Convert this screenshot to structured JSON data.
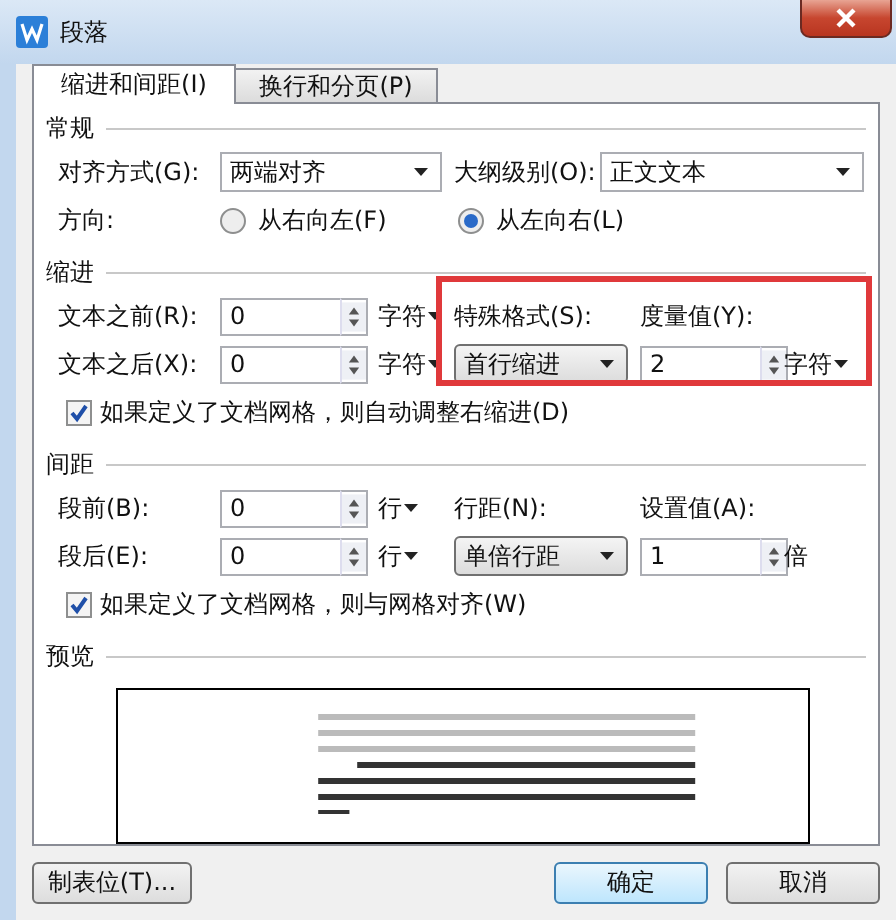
{
  "window": {
    "title": "段落"
  },
  "tabs": [
    {
      "label": "缩进和间距(I)",
      "selected": true
    },
    {
      "label": "换行和分页(P)",
      "selected": false
    }
  ],
  "general": {
    "label": "常规",
    "alignment": {
      "label": "对齐方式(G):",
      "value": "两端对齐",
      "kind": "field"
    },
    "outline_level": {
      "label": "大纲级别(O):",
      "value": "正文文本",
      "kind": "field"
    },
    "direction": {
      "label": "方向:",
      "options": [
        {
          "label": "从右向左(F)",
          "selected": false
        },
        {
          "label": "从左向右(L)",
          "selected": true
        }
      ]
    }
  },
  "indent": {
    "label": "缩进",
    "before": {
      "label": "文本之前(R):",
      "value": "0",
      "unit": "字符",
      "menu": true
    },
    "after": {
      "label": "文本之后(X):",
      "value": "0",
      "unit": "字符",
      "menu": true
    },
    "special": {
      "label": "特殊格式(S):",
      "value": "首行缩进",
      "kind": "button"
    },
    "measure": {
      "label": "度量值(Y):",
      "value": "2",
      "unit": "字符",
      "menu": true
    },
    "auto_adjust": {
      "label": "如果定义了文档网格，则自动调整右缩进(D)",
      "checked": true
    }
  },
  "spacing": {
    "label": "间距",
    "before": {
      "label": "段前(B):",
      "value": "0",
      "unit": "行",
      "menu": true
    },
    "after": {
      "label": "段后(E):",
      "value": "0",
      "unit": "行",
      "menu": true
    },
    "line_spacing": {
      "label": "行距(N):",
      "value": "单倍行距",
      "kind": "button"
    },
    "at": {
      "label": "设置值(A):",
      "value": "1",
      "unit": "倍",
      "menu": false
    },
    "snap_to_grid": {
      "label": "如果定义了文档网格，则与网格对齐(W)",
      "checked": true
    }
  },
  "preview": {
    "label": "预览"
  },
  "buttons": [
    {
      "label": "制表位(T)...",
      "default": false
    },
    {
      "label": "确定",
      "default": true
    },
    {
      "label": "取消",
      "default": false
    }
  ]
}
